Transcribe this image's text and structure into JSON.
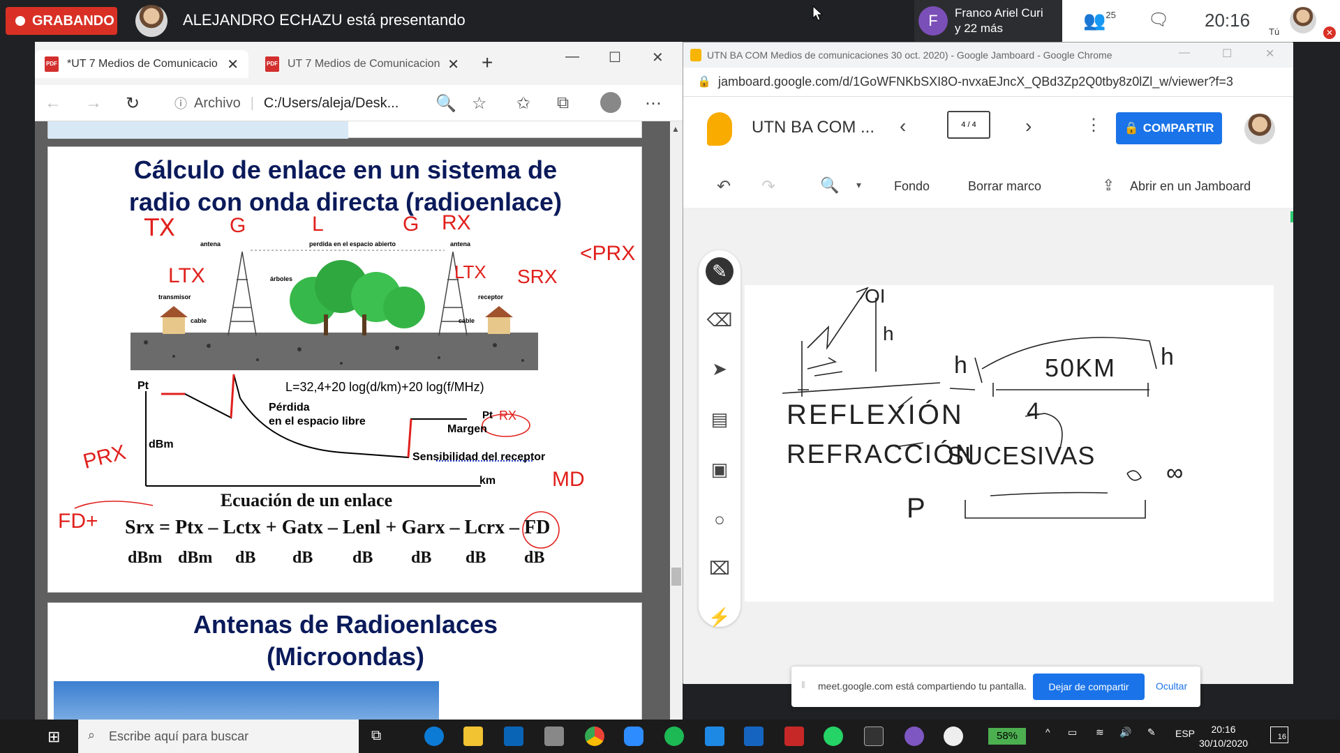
{
  "meet": {
    "recording_label": "GRABANDO",
    "presenting_text": "ALEJANDRO ECHAZU está presentando",
    "participant_initial": "F",
    "participant_name_line1": "Franco Ariel Curi",
    "participant_name_line2": "y 22 más",
    "people_count": "25",
    "time": "20:16",
    "self_label": "Tú",
    "colors": {
      "recording": "#d93025",
      "participant_avatar": "#7b4fb8"
    }
  },
  "edge": {
    "tabs": [
      {
        "label": "*UT 7 Medios de Comunicacio"
      },
      {
        "label": "UT 7 Medios de Comunicacion"
      }
    ],
    "address_label": "Archivo",
    "address_path": "C:/Users/aleja/Desk...",
    "slide1": {
      "title_line1": "Cálculo de enlace en un sistema de",
      "title_line2": "radio con onda directa (radioenlace)",
      "labels": {
        "antena_left": "antena",
        "antena_right": "antena",
        "free_space": "perdida en el espacio abierto",
        "trees": "árboles",
        "transmitter": "transmisor",
        "receiver": "receptor",
        "cable_left": "cable",
        "cable_right": "cable",
        "pt": "Pt",
        "formula": "L=32,4+20 log(d/km)+20 log(f/MHz)",
        "loss_line1": "Pérdida",
        "loss_line2": "en el espacio libre",
        "dbm": "dBm",
        "pt_rx": "Pt",
        "margin": "Margen",
        "sensitivity": "Sensibilidad del receptor",
        "km": "km"
      },
      "equation_title": "Ecuación de un enlace",
      "equation": "Srx = Ptx – Lctx + Gatx – Lenl + Garx – Lcrx – FD",
      "units": [
        "dBm",
        "dBm",
        "dB",
        "dB",
        "dB",
        "dB",
        "dB",
        "dB"
      ],
      "handwriting": {
        "tx": "TX",
        "g1": "G",
        "l": "L",
        "g2": "G",
        "rx": "RX",
        "ltx1": "LTX",
        "ltx2": "LTX",
        "srx": "SRX",
        "lt_prx": "<PRX",
        "prx": "PRX",
        "rx_circle": "RX",
        "md": "MD",
        "fd_plus": "FD+"
      }
    },
    "slide2": {
      "title_line1": "Antenas de Radioenlaces",
      "title_line2": "(Microondas)"
    }
  },
  "chrome": {
    "window_title": "UTN BA COM Medios de comunicaciones 30 oct. 2020) - Google Jamboard - Google Chrome",
    "url": "jamboard.google.com/d/1GoWFNKbSXI8O-nvxaEJncX_QBd3Zp2Q0tby8z0lZl_w/viewer?f=3",
    "jam_title": "UTN BA COM ...",
    "frame_counter": "4 / 4",
    "share_label": "COMPARTIR",
    "toolbar": {
      "background": "Fondo",
      "clear_frame": "Borrar marco",
      "open_jamboard": "Abrir en un Jamboard"
    },
    "handwriting": {
      "oi": "OI",
      "h1": "h",
      "h2": "h",
      "h3": "h",
      "km50": "50KM",
      "reflexion": "REFLEXIÓN",
      "refraccion": "REFRACCIÓN",
      "sucesivas": "SUCESIVAS",
      "num4": "4",
      "p": "P",
      "inf": "∞"
    },
    "share_bar": {
      "message": "meet.google.com está compartiendo tu pantalla.",
      "stop": "Dejar de compartir",
      "hide": "Ocultar"
    },
    "colors": {
      "share": "#1a73e8"
    }
  },
  "taskbar": {
    "search_placeholder": "Escribe aquí para buscar",
    "battery": "58%",
    "language": "ESP",
    "time": "20:16",
    "date": "30/10/2020",
    "notifications": "16"
  }
}
